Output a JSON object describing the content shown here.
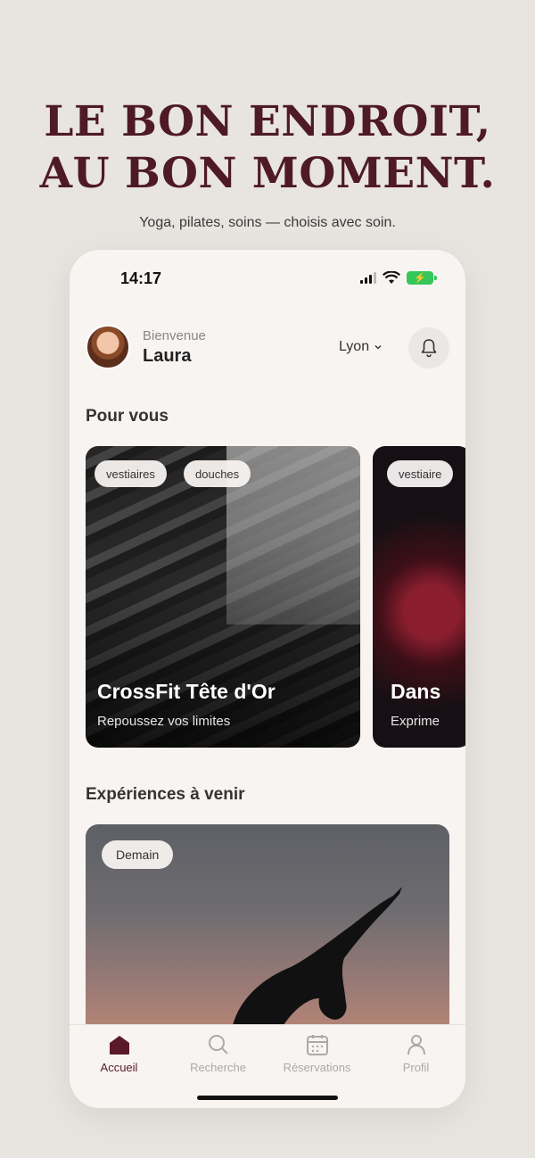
{
  "marketing": {
    "headline_line1": "LE BON ENDROIT,",
    "headline_line2": "AU BON MOMENT.",
    "subtitle": "Yoga, pilates, soins — choisis avec soin."
  },
  "status_bar": {
    "time": "14:17",
    "icons": [
      "signal-icon",
      "wifi-icon",
      "battery-charging-icon"
    ]
  },
  "header": {
    "greeting": "Bienvenue",
    "user_name": "Laura",
    "city": "Lyon",
    "city_icon": "chevron-down-icon",
    "notification_icon": "bell-icon"
  },
  "for_you": {
    "title": "Pour vous",
    "cards": [
      {
        "tags": [
          "vestiaires",
          "douches"
        ],
        "title": "CrossFit Tête d'Or",
        "subtitle": "Repoussez vos limites"
      },
      {
        "tags": [
          "vestiaire"
        ],
        "title": "Dans",
        "subtitle": "Exprime"
      }
    ]
  },
  "upcoming": {
    "title": "Expériences à venir",
    "card": {
      "tag": "Demain"
    }
  },
  "tab_bar": {
    "items": [
      {
        "label": "Accueil",
        "icon": "home-icon",
        "active": true
      },
      {
        "label": "Recherche",
        "icon": "search-icon",
        "active": false
      },
      {
        "label": "Réservations",
        "icon": "calendar-icon",
        "active": false
      },
      {
        "label": "Profil",
        "icon": "user-icon",
        "active": false
      }
    ]
  },
  "colors": {
    "brand": "#4e1a24",
    "background": "#e8e4df",
    "screen": "#f7f4f2",
    "battery": "#35c759"
  }
}
